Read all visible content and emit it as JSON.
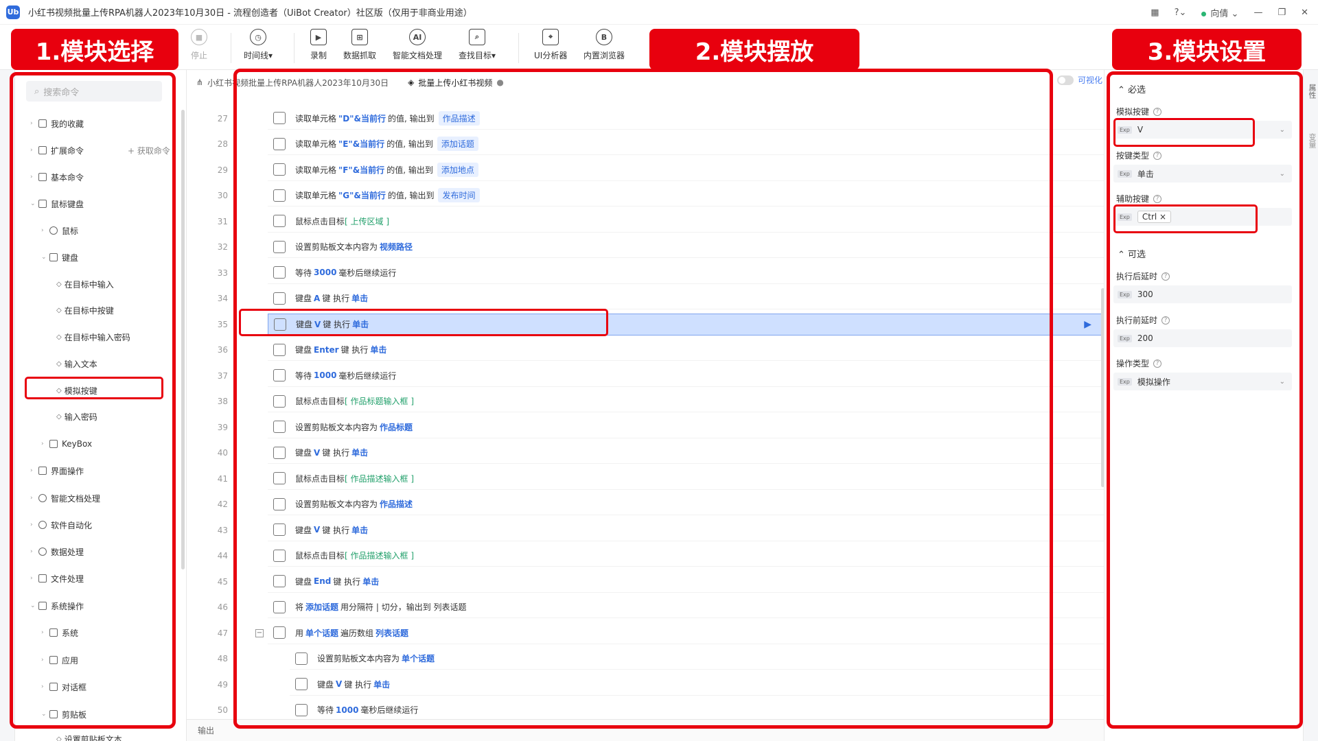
{
  "window": {
    "title": "小红书视频批量上传RPA机器人2023年10月30日 - 流程创造者（UiBot Creator）社区版（仅用于非商业用途）",
    "logo": "Ub",
    "user": "向倩",
    "controls": [
      "grid-icon",
      "help-icon",
      "minimize-icon",
      "restore-icon",
      "close-icon"
    ]
  },
  "toolbar": {
    "stop": "停止",
    "timeline": "时间线▾",
    "record": "录制",
    "data_capture": "数据抓取",
    "doc_process": "智能文档处理",
    "find_target": "查找目标▾",
    "ui_analyzer": "UI分析器",
    "browser": "内置浏览器"
  },
  "annotations": {
    "label1": "1.模块选择",
    "label2": "2.模块摆放",
    "label3": "3.模块设置"
  },
  "left": {
    "search_placeholder": "搜索命令",
    "get_commands": "+ 获取命令",
    "tree": [
      "我的收藏",
      "扩展命令",
      "基本命令",
      "鼠标键盘",
      "鼠标",
      "键盘",
      "在目标中输入",
      "在目标中按键",
      "在目标中输入密码",
      "输入文本",
      "模拟按键",
      "输入密码",
      "KeyBox",
      "界面操作",
      "智能文档处理",
      "软件自动化",
      "数据处理",
      "文件处理",
      "系统操作",
      "系统",
      "应用",
      "对话框",
      "剪贴板",
      "设置剪贴板文本"
    ]
  },
  "tabs": {
    "tab1": "小红书视频批量上传RPA机器人2023年10月30日",
    "tab2": "批量上传小红书视频",
    "visualize": "可视化"
  },
  "code": {
    "rows": [
      {
        "ln": "27",
        "pre": "读取单元格",
        "kw": "\"D\"&当前行",
        "mid": "的值, 输出到",
        "tag": "作品描述"
      },
      {
        "ln": "28",
        "pre": "读取单元格",
        "kw": "\"E\"&当前行",
        "mid": "的值, 输出到",
        "tag": "添加话题"
      },
      {
        "ln": "29",
        "pre": "读取单元格",
        "kw": "\"F\"&当前行",
        "mid": "的值, 输出到",
        "tag": "添加地点"
      },
      {
        "ln": "30",
        "pre": "读取单元格",
        "kw": "\"G\"&当前行",
        "mid": "的值, 输出到",
        "tag": "发布时间"
      },
      {
        "ln": "31",
        "pre": "鼠标点击目标",
        "tgt": "[ 上传区域        ]"
      },
      {
        "ln": "32",
        "pre": "设置剪贴板文本内容为",
        "kw": "视频路径"
      },
      {
        "ln": "33",
        "pre": "等待",
        "kw": "3000",
        "mid": "毫秒后继续运行"
      },
      {
        "ln": "34",
        "pre": "键盘",
        "kw": "A",
        "mid": "键 执行",
        "kw2": "单击"
      },
      {
        "ln": "35",
        "pre": "键盘",
        "kw": "V",
        "mid": "键 执行",
        "kw2": "单击"
      },
      {
        "ln": "36",
        "pre": "键盘",
        "kw": "Enter",
        "mid": "键 执行",
        "kw2": "单击"
      },
      {
        "ln": "37",
        "pre": "等待",
        "kw": "1000",
        "mid": "毫秒后继续运行"
      },
      {
        "ln": "38",
        "pre": "鼠标点击目标",
        "tgt": "[ 作品标题输入框          ]"
      },
      {
        "ln": "39",
        "pre": "设置剪贴板文本内容为",
        "kw": "作品标题"
      },
      {
        "ln": "40",
        "pre": "键盘",
        "kw": "V",
        "mid": "键 执行",
        "kw2": "单击"
      },
      {
        "ln": "41",
        "pre": "鼠标点击目标",
        "tgt": "[ 作品描述输入框          ]"
      },
      {
        "ln": "42",
        "pre": "设置剪贴板文本内容为",
        "kw": "作品描述"
      },
      {
        "ln": "43",
        "pre": "键盘",
        "kw": "V",
        "mid": "键 执行",
        "kw2": "单击"
      },
      {
        "ln": "44",
        "pre": "鼠标点击目标",
        "tgt": "[ 作品描述输入框          ]"
      },
      {
        "ln": "45",
        "pre": "键盘",
        "kw": "End",
        "mid": "键 执行",
        "kw2": "单击"
      },
      {
        "ln": "46",
        "pre": "将",
        "kw": "添加话题",
        "mid": "用分隔符 | 切分，输出到 列表话题"
      },
      {
        "ln": "47",
        "pre": "用",
        "kw": "单个话题",
        "mid": "遍历数组",
        "kw2": "列表话题"
      },
      {
        "ln": "48",
        "pre": "设置剪贴板文本内容为",
        "kw": "单个话题"
      },
      {
        "ln": "49",
        "pre": "键盘",
        "kw": "V",
        "mid": "键 执行",
        "kw2": "单击"
      },
      {
        "ln": "50",
        "pre": "等待",
        "kw": "1000",
        "mid": "毫秒后继续运行"
      }
    ],
    "output_label": "输出"
  },
  "right": {
    "required": "必选",
    "sim_key_label": "模拟按键",
    "sim_key_value": "V",
    "key_type_label": "按键类型",
    "key_type_value": "单击",
    "aux_key_label": "辅助按键",
    "aux_key_value": "Ctrl ×",
    "optional": "可选",
    "after_delay_label": "执行后延时",
    "after_delay_value": "300",
    "before_delay_label": "执行前延时",
    "before_delay_value": "200",
    "op_type_label": "操作类型",
    "op_type_value": "模拟操作",
    "exp": "Exp",
    "side_tab1": "属性",
    "side_tab2": "变量"
  },
  "colors": {
    "accent": "#2f6bdc",
    "annotation_red": "#e8000e",
    "selected_row": "#cfe0ff",
    "target_green": "#22a06b"
  }
}
